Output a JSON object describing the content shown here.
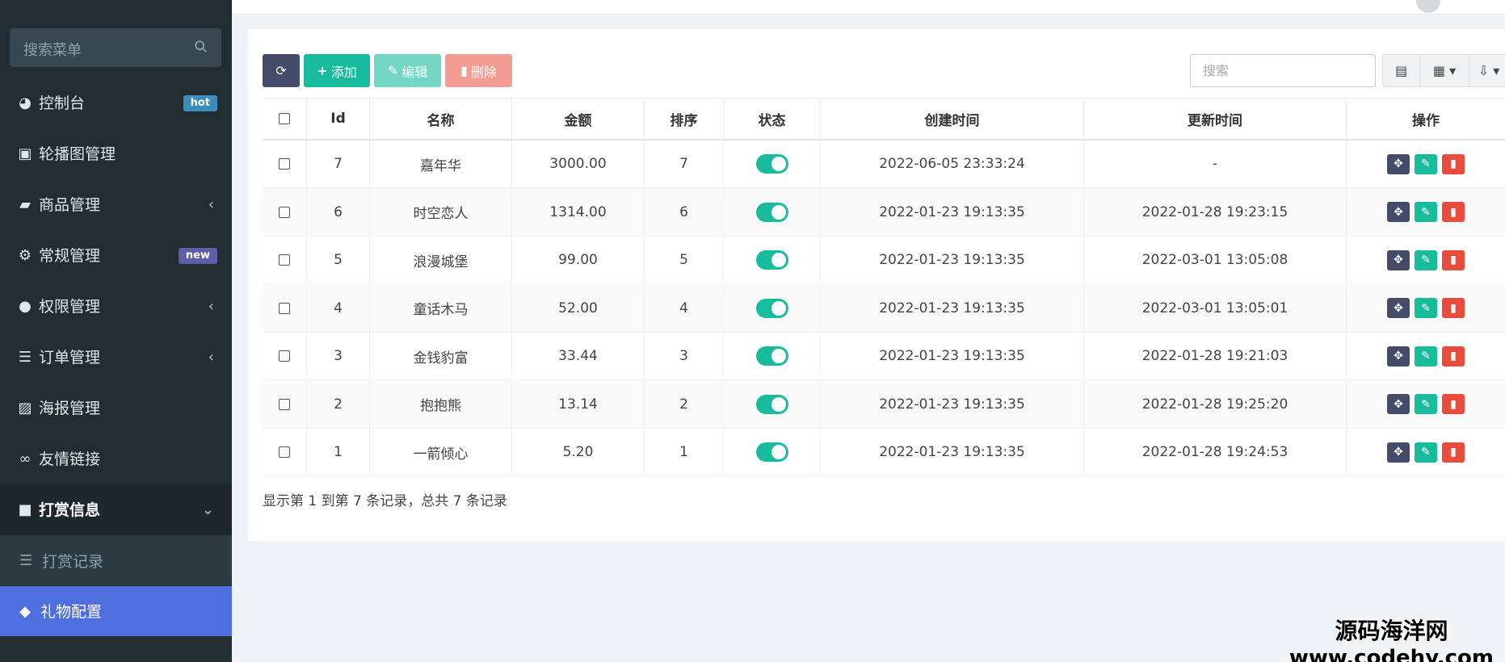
{
  "sidebar": {
    "search_placeholder": "搜索菜单",
    "items": [
      {
        "label": "控制台",
        "badge": "hot"
      },
      {
        "label": "轮播图管理"
      },
      {
        "label": "商品管理",
        "chevron": "‹"
      },
      {
        "label": "常规管理",
        "badge": "new"
      },
      {
        "label": "权限管理",
        "chevron": "‹"
      },
      {
        "label": "订单管理",
        "chevron": "‹"
      },
      {
        "label": "海报管理"
      },
      {
        "label": "友情链接"
      },
      {
        "label": "打赏信息",
        "chevron": "⌄"
      }
    ],
    "submenu_label": "打赏记录",
    "active_label": "礼物配置"
  },
  "toolbar": {
    "add_label": "添加",
    "edit_label": "编辑",
    "delete_label": "删除",
    "search_placeholder": "搜索"
  },
  "table": {
    "headers": [
      "Id",
      "名称",
      "金额",
      "排序",
      "状态",
      "创建时间",
      "更新时间",
      "操作"
    ],
    "rows": [
      {
        "id": "7",
        "name": "嘉年华",
        "amount": "3000.00",
        "sort": "7",
        "created": "2022-06-05 23:33:24",
        "updated": "-"
      },
      {
        "id": "6",
        "name": "时空恋人",
        "amount": "1314.00",
        "sort": "6",
        "created": "2022-01-23 19:13:35",
        "updated": "2022-01-28 19:23:15"
      },
      {
        "id": "5",
        "name": "浪漫城堡",
        "amount": "99.00",
        "sort": "5",
        "created": "2022-01-23 19:13:35",
        "updated": "2022-03-01 13:05:08"
      },
      {
        "id": "4",
        "name": "童话木马",
        "amount": "52.00",
        "sort": "4",
        "created": "2022-01-23 19:13:35",
        "updated": "2022-03-01 13:05:01"
      },
      {
        "id": "3",
        "name": "金钱豹富",
        "amount": "33.44",
        "sort": "3",
        "created": "2022-01-23 19:13:35",
        "updated": "2022-01-28 19:21:03"
      },
      {
        "id": "2",
        "name": "抱抱熊",
        "amount": "13.14",
        "sort": "2",
        "created": "2022-01-23 19:13:35",
        "updated": "2022-01-28 19:25:20"
      },
      {
        "id": "1",
        "name": "一箭倾心",
        "amount": "5.20",
        "sort": "1",
        "created": "2022-01-23 19:13:35",
        "updated": "2022-01-28 19:24:53"
      }
    ]
  },
  "footer": {
    "summary": "显示第 1 到第 7 条记录，总共 7 条记录"
  },
  "watermark": {
    "line1": "源码海洋网",
    "line2": "www.codehy.com"
  },
  "colors": {
    "sidebar_bg": "#222d32",
    "active_menu": "#4f6fde",
    "primary": "#444c69",
    "success": "#18bc9c",
    "danger": "#e74c3c"
  }
}
